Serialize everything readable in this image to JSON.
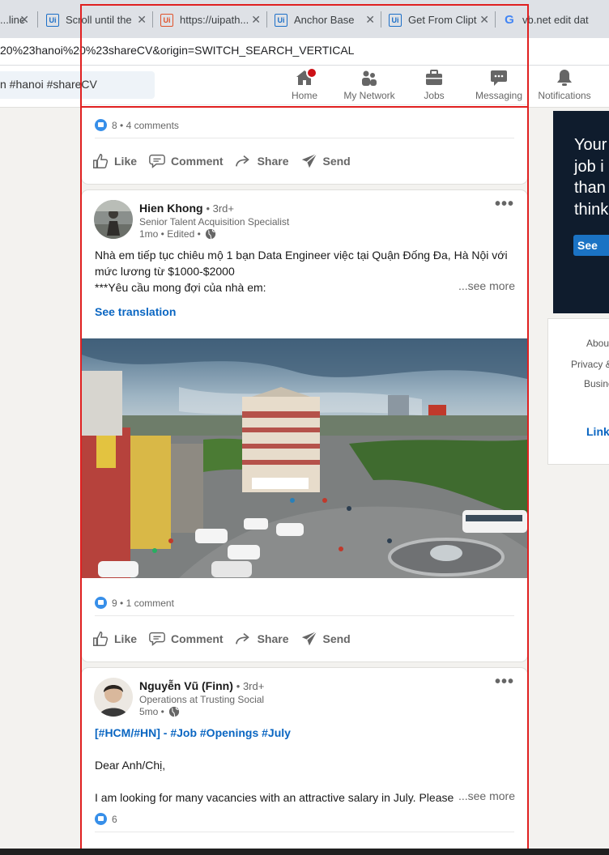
{
  "browser": {
    "tabs": [
      {
        "icon": "uipath-icon",
        "title": "...line"
      },
      {
        "icon": "uipath-icon",
        "title": "Scroll until the"
      },
      {
        "icon": "uipath-orange-icon",
        "title": "https://uipath..."
      },
      {
        "icon": "uipath-icon",
        "title": "Anchor Base"
      },
      {
        "icon": "uipath-icon",
        "title": "Get From Clipt"
      },
      {
        "icon": "google-icon",
        "title": "vb.net edit dat"
      }
    ],
    "url": "20%23hanoi%20%23shareCV&origin=SWITCH_SEARCH_VERTICAL"
  },
  "linkedin_nav": {
    "search_value": "n #hanoi #shareCV",
    "items": [
      {
        "label": "Home",
        "icon": "home-icon"
      },
      {
        "label": "My Network",
        "icon": "network-icon"
      },
      {
        "label": "Jobs",
        "icon": "briefcase-icon"
      },
      {
        "label": "Messaging",
        "icon": "messaging-icon"
      },
      {
        "label": "Notifications",
        "icon": "bell-icon"
      }
    ]
  },
  "feed": {
    "post0": {
      "reactions": "8",
      "comments": "4 comments"
    },
    "actions": {
      "like": "Like",
      "comment": "Comment",
      "share": "Share",
      "send": "Send"
    },
    "post1": {
      "author": "Hien Khong",
      "degree": "• 3rd+",
      "headline": "Senior Talent Acquisition Specialist",
      "time": "1mo • Edited •",
      "text_line1": "Nhà em tiếp tục chiêu mộ 1 bạn Data Engineer việc tại Quận Đống Đa, Hà Nội với",
      "text_line2": "mức lương từ $1000-$2000",
      "text_line3": "***Yêu cầu mong đợi của nhà em:",
      "see_more": "...see more",
      "see_translation": "See translation",
      "reactions": "9",
      "comments": "1 comment"
    },
    "post2": {
      "author": "Nguyễn Vũ (Finn)",
      "degree": "• 3rd+",
      "headline": "Operations at Trusting Social",
      "time": "5mo •",
      "tags": "[#HCM/#HN] - #Job #Openings #July",
      "greeting": "Dear Anh/Chị,",
      "text": "I am looking for many vacancies with an attractive salary in July. Please c",
      "see_more": "...see more",
      "reactions": "6"
    }
  },
  "right_rail": {
    "ad_lines": [
      "Your",
      "job i",
      "than",
      "think"
    ],
    "ad_button": "See",
    "footer_links": [
      "About",
      "Privacy &",
      "Busine"
    ],
    "brand": "Linke"
  },
  "colors": {
    "linkedin_blue": "#0a66c2",
    "annotation_red": "#e02020",
    "notification_red": "#cc1016"
  }
}
